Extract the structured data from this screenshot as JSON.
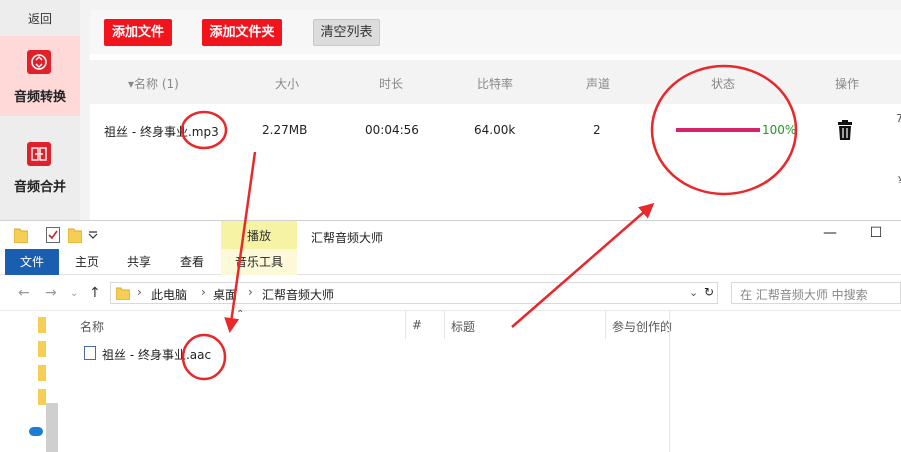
{
  "app": {
    "back_label": "返回",
    "sidebar": [
      {
        "label": "音频转换",
        "active": true,
        "icon": "audio-convert-icon"
      },
      {
        "label": "音频合并",
        "active": false,
        "icon": "audio-merge-icon"
      }
    ],
    "toolbar": {
      "add_file": "添加文件",
      "add_folder": "添加文件夹",
      "clear_list": "清空列表"
    },
    "table": {
      "headers": {
        "name": "▾名称 (1)",
        "size": "大小",
        "duration": "时长",
        "bitrate": "比特率",
        "channels": "声道",
        "status": "状态",
        "action": "操作"
      },
      "rows": [
        {
          "name": "祖丝 - 终身事业.mp3",
          "size": "2.27MB",
          "duration": "00:04:56",
          "bitrate": "64.00k",
          "channels": "2",
          "progress_percent": 100,
          "progress_text": "100%"
        }
      ]
    },
    "colors": {
      "accent": "#f2141c",
      "progress": "#d6246a",
      "progress_text": "#1f9a1f"
    }
  },
  "explorer": {
    "tool_tab": "播放",
    "window_title": "汇帮音频大师",
    "ribbon_tabs": [
      "文件",
      "主页",
      "共享",
      "查看"
    ],
    "music_tools": "音乐工具",
    "breadcrumb": [
      "此电脑",
      "桌面",
      "汇帮音频大师"
    ],
    "search_placeholder": "在 汇帮音频大师 中搜索",
    "columns": {
      "name": "名称",
      "number": "#",
      "title": "标题",
      "contrib": "参与创作的"
    },
    "files": [
      {
        "name": "祖丝 - 终身事业.aac"
      }
    ],
    "colors": {
      "file_tab": "#1a5eb0",
      "play_tab": "#f7f3a5"
    }
  },
  "annotation_color": "#e8282a"
}
